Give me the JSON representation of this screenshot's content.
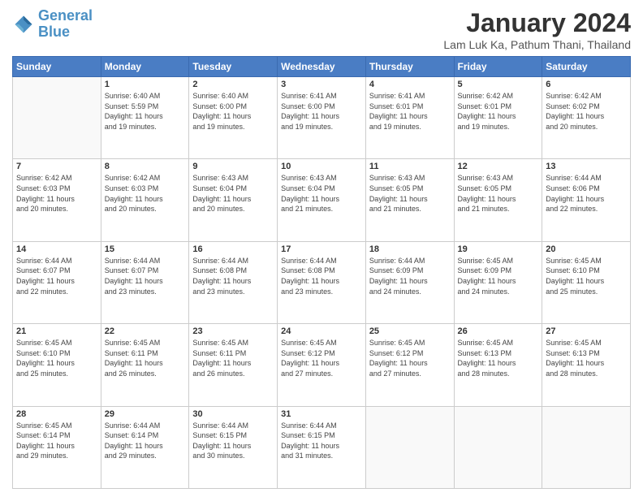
{
  "header": {
    "logo_line1": "General",
    "logo_line2": "Blue",
    "title": "January 2024",
    "subtitle": "Lam Luk Ka, Pathum Thani, Thailand"
  },
  "weekdays": [
    "Sunday",
    "Monday",
    "Tuesday",
    "Wednesday",
    "Thursday",
    "Friday",
    "Saturday"
  ],
  "weeks": [
    [
      {
        "day": "",
        "info": ""
      },
      {
        "day": "1",
        "info": "Sunrise: 6:40 AM\nSunset: 5:59 PM\nDaylight: 11 hours\nand 19 minutes."
      },
      {
        "day": "2",
        "info": "Sunrise: 6:40 AM\nSunset: 6:00 PM\nDaylight: 11 hours\nand 19 minutes."
      },
      {
        "day": "3",
        "info": "Sunrise: 6:41 AM\nSunset: 6:00 PM\nDaylight: 11 hours\nand 19 minutes."
      },
      {
        "day": "4",
        "info": "Sunrise: 6:41 AM\nSunset: 6:01 PM\nDaylight: 11 hours\nand 19 minutes."
      },
      {
        "day": "5",
        "info": "Sunrise: 6:42 AM\nSunset: 6:01 PM\nDaylight: 11 hours\nand 19 minutes."
      },
      {
        "day": "6",
        "info": "Sunrise: 6:42 AM\nSunset: 6:02 PM\nDaylight: 11 hours\nand 20 minutes."
      }
    ],
    [
      {
        "day": "7",
        "info": "Sunrise: 6:42 AM\nSunset: 6:03 PM\nDaylight: 11 hours\nand 20 minutes."
      },
      {
        "day": "8",
        "info": "Sunrise: 6:42 AM\nSunset: 6:03 PM\nDaylight: 11 hours\nand 20 minutes."
      },
      {
        "day": "9",
        "info": "Sunrise: 6:43 AM\nSunset: 6:04 PM\nDaylight: 11 hours\nand 20 minutes."
      },
      {
        "day": "10",
        "info": "Sunrise: 6:43 AM\nSunset: 6:04 PM\nDaylight: 11 hours\nand 21 minutes."
      },
      {
        "day": "11",
        "info": "Sunrise: 6:43 AM\nSunset: 6:05 PM\nDaylight: 11 hours\nand 21 minutes."
      },
      {
        "day": "12",
        "info": "Sunrise: 6:43 AM\nSunset: 6:05 PM\nDaylight: 11 hours\nand 21 minutes."
      },
      {
        "day": "13",
        "info": "Sunrise: 6:44 AM\nSunset: 6:06 PM\nDaylight: 11 hours\nand 22 minutes."
      }
    ],
    [
      {
        "day": "14",
        "info": "Sunrise: 6:44 AM\nSunset: 6:07 PM\nDaylight: 11 hours\nand 22 minutes."
      },
      {
        "day": "15",
        "info": "Sunrise: 6:44 AM\nSunset: 6:07 PM\nDaylight: 11 hours\nand 23 minutes."
      },
      {
        "day": "16",
        "info": "Sunrise: 6:44 AM\nSunset: 6:08 PM\nDaylight: 11 hours\nand 23 minutes."
      },
      {
        "day": "17",
        "info": "Sunrise: 6:44 AM\nSunset: 6:08 PM\nDaylight: 11 hours\nand 23 minutes."
      },
      {
        "day": "18",
        "info": "Sunrise: 6:44 AM\nSunset: 6:09 PM\nDaylight: 11 hours\nand 24 minutes."
      },
      {
        "day": "19",
        "info": "Sunrise: 6:45 AM\nSunset: 6:09 PM\nDaylight: 11 hours\nand 24 minutes."
      },
      {
        "day": "20",
        "info": "Sunrise: 6:45 AM\nSunset: 6:10 PM\nDaylight: 11 hours\nand 25 minutes."
      }
    ],
    [
      {
        "day": "21",
        "info": "Sunrise: 6:45 AM\nSunset: 6:10 PM\nDaylight: 11 hours\nand 25 minutes."
      },
      {
        "day": "22",
        "info": "Sunrise: 6:45 AM\nSunset: 6:11 PM\nDaylight: 11 hours\nand 26 minutes."
      },
      {
        "day": "23",
        "info": "Sunrise: 6:45 AM\nSunset: 6:11 PM\nDaylight: 11 hours\nand 26 minutes."
      },
      {
        "day": "24",
        "info": "Sunrise: 6:45 AM\nSunset: 6:12 PM\nDaylight: 11 hours\nand 27 minutes."
      },
      {
        "day": "25",
        "info": "Sunrise: 6:45 AM\nSunset: 6:12 PM\nDaylight: 11 hours\nand 27 minutes."
      },
      {
        "day": "26",
        "info": "Sunrise: 6:45 AM\nSunset: 6:13 PM\nDaylight: 11 hours\nand 28 minutes."
      },
      {
        "day": "27",
        "info": "Sunrise: 6:45 AM\nSunset: 6:13 PM\nDaylight: 11 hours\nand 28 minutes."
      }
    ],
    [
      {
        "day": "28",
        "info": "Sunrise: 6:45 AM\nSunset: 6:14 PM\nDaylight: 11 hours\nand 29 minutes."
      },
      {
        "day": "29",
        "info": "Sunrise: 6:44 AM\nSunset: 6:14 PM\nDaylight: 11 hours\nand 29 minutes."
      },
      {
        "day": "30",
        "info": "Sunrise: 6:44 AM\nSunset: 6:15 PM\nDaylight: 11 hours\nand 30 minutes."
      },
      {
        "day": "31",
        "info": "Sunrise: 6:44 AM\nSunset: 6:15 PM\nDaylight: 11 hours\nand 31 minutes."
      },
      {
        "day": "",
        "info": ""
      },
      {
        "day": "",
        "info": ""
      },
      {
        "day": "",
        "info": ""
      }
    ]
  ]
}
